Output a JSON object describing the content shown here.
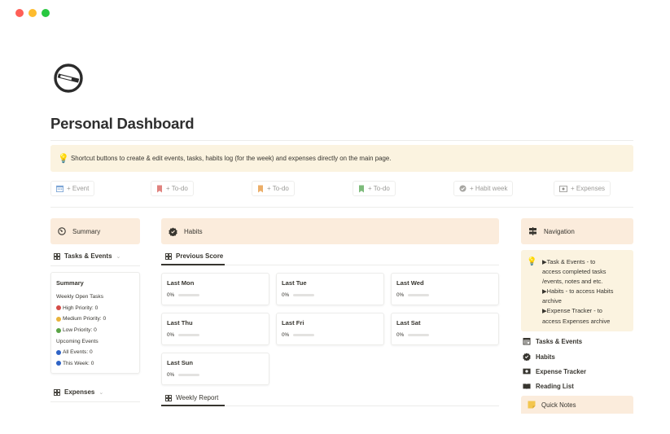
{
  "window": {
    "colors": [
      "#ff5f57",
      "#febc2e",
      "#28c840"
    ]
  },
  "page": {
    "icon": "no-smoking-icon",
    "title": "Personal Dashboard"
  },
  "callout": {
    "icon": "lightbulb-icon",
    "text": "Shortcut buttons to create & edit events, tasks, habits log (for the week) and expenses directly on the main page."
  },
  "shortcuts": [
    {
      "label": "+ Event",
      "icon": "calendar-icon"
    },
    {
      "label": "+ To-do",
      "icon": "bookmark-red-icon"
    },
    {
      "label": "+ To-do",
      "icon": "bookmark-orange-icon"
    },
    {
      "label": "+ To-do",
      "icon": "bookmark-green-icon"
    },
    {
      "label": "+ Habit week",
      "icon": "check-circle-icon"
    },
    {
      "label": "+ Expenses",
      "icon": "banknote-icon"
    }
  ],
  "summary": {
    "header": "Summary",
    "tasks_tab": "Tasks & Events",
    "card": {
      "title": "Summary",
      "rows": [
        {
          "text": "Weekly Open Tasks",
          "dot": ""
        },
        {
          "text": "High Priority: 0",
          "dot": "#d44c47"
        },
        {
          "text": "Medium Priority: 0",
          "dot": "#e9b33b"
        },
        {
          "text": "Low Priority: 0",
          "dot": "#5aa345"
        },
        {
          "text": "Upcoming Events",
          "dot": ""
        },
        {
          "text": "All Events: 0",
          "dot": "#2e63c5"
        },
        {
          "text": "This Week: 0",
          "dot": "#2e63c5"
        }
      ]
    },
    "expenses_tab": "Expenses"
  },
  "habits": {
    "header": "Habits",
    "previous_tab": "Previous Score",
    "scores": [
      {
        "label": "Last Mon",
        "value": "0%",
        "progress": 0
      },
      {
        "label": "Last Tue",
        "value": "0%",
        "progress": 0
      },
      {
        "label": "Last Wed",
        "value": "0%",
        "progress": 0
      },
      {
        "label": "Last Thu",
        "value": "0%",
        "progress": 0
      },
      {
        "label": "Last Fri",
        "value": "0%",
        "progress": 0
      },
      {
        "label": "Last Sat",
        "value": "0%",
        "progress": 0
      },
      {
        "label": "Last Sun",
        "value": "0%",
        "progress": 0
      }
    ],
    "weekly_tab": "Weekly Report"
  },
  "navigation": {
    "header": "Navigation",
    "callout_lines": [
      "▶Task & Events - to",
      "access completed tasks",
      "/events, notes and etc.",
      "▶Habits - to access Habits",
      "archive",
      "▶Expense Tracker - to",
      "access Expenses archive"
    ],
    "links": [
      {
        "label": "Tasks & Events",
        "icon": "calendar-icon"
      },
      {
        "label": "Habits",
        "icon": "check-circle-icon"
      },
      {
        "label": "Expense Tracker",
        "icon": "banknote-icon"
      },
      {
        "label": "Reading List",
        "icon": "book-icon"
      }
    ],
    "quick_notes": "Quick Notes"
  }
}
